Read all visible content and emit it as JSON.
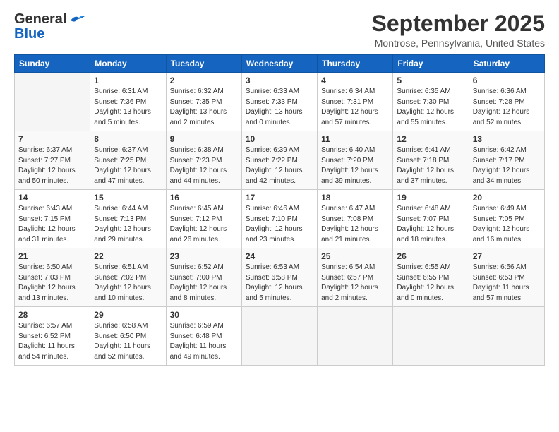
{
  "logo": {
    "line1": "General",
    "line2": "Blue"
  },
  "title": "September 2025",
  "location": "Montrose, Pennsylvania, United States",
  "days_of_week": [
    "Sunday",
    "Monday",
    "Tuesday",
    "Wednesday",
    "Thursday",
    "Friday",
    "Saturday"
  ],
  "weeks": [
    [
      {
        "day": "",
        "info": ""
      },
      {
        "day": "1",
        "info": "Sunrise: 6:31 AM\nSunset: 7:36 PM\nDaylight: 13 hours\nand 5 minutes."
      },
      {
        "day": "2",
        "info": "Sunrise: 6:32 AM\nSunset: 7:35 PM\nDaylight: 13 hours\nand 2 minutes."
      },
      {
        "day": "3",
        "info": "Sunrise: 6:33 AM\nSunset: 7:33 PM\nDaylight: 13 hours\nand 0 minutes."
      },
      {
        "day": "4",
        "info": "Sunrise: 6:34 AM\nSunset: 7:31 PM\nDaylight: 12 hours\nand 57 minutes."
      },
      {
        "day": "5",
        "info": "Sunrise: 6:35 AM\nSunset: 7:30 PM\nDaylight: 12 hours\nand 55 minutes."
      },
      {
        "day": "6",
        "info": "Sunrise: 6:36 AM\nSunset: 7:28 PM\nDaylight: 12 hours\nand 52 minutes."
      }
    ],
    [
      {
        "day": "7",
        "info": "Sunrise: 6:37 AM\nSunset: 7:27 PM\nDaylight: 12 hours\nand 50 minutes."
      },
      {
        "day": "8",
        "info": "Sunrise: 6:37 AM\nSunset: 7:25 PM\nDaylight: 12 hours\nand 47 minutes."
      },
      {
        "day": "9",
        "info": "Sunrise: 6:38 AM\nSunset: 7:23 PM\nDaylight: 12 hours\nand 44 minutes."
      },
      {
        "day": "10",
        "info": "Sunrise: 6:39 AM\nSunset: 7:22 PM\nDaylight: 12 hours\nand 42 minutes."
      },
      {
        "day": "11",
        "info": "Sunrise: 6:40 AM\nSunset: 7:20 PM\nDaylight: 12 hours\nand 39 minutes."
      },
      {
        "day": "12",
        "info": "Sunrise: 6:41 AM\nSunset: 7:18 PM\nDaylight: 12 hours\nand 37 minutes."
      },
      {
        "day": "13",
        "info": "Sunrise: 6:42 AM\nSunset: 7:17 PM\nDaylight: 12 hours\nand 34 minutes."
      }
    ],
    [
      {
        "day": "14",
        "info": "Sunrise: 6:43 AM\nSunset: 7:15 PM\nDaylight: 12 hours\nand 31 minutes."
      },
      {
        "day": "15",
        "info": "Sunrise: 6:44 AM\nSunset: 7:13 PM\nDaylight: 12 hours\nand 29 minutes."
      },
      {
        "day": "16",
        "info": "Sunrise: 6:45 AM\nSunset: 7:12 PM\nDaylight: 12 hours\nand 26 minutes."
      },
      {
        "day": "17",
        "info": "Sunrise: 6:46 AM\nSunset: 7:10 PM\nDaylight: 12 hours\nand 23 minutes."
      },
      {
        "day": "18",
        "info": "Sunrise: 6:47 AM\nSunset: 7:08 PM\nDaylight: 12 hours\nand 21 minutes."
      },
      {
        "day": "19",
        "info": "Sunrise: 6:48 AM\nSunset: 7:07 PM\nDaylight: 12 hours\nand 18 minutes."
      },
      {
        "day": "20",
        "info": "Sunrise: 6:49 AM\nSunset: 7:05 PM\nDaylight: 12 hours\nand 16 minutes."
      }
    ],
    [
      {
        "day": "21",
        "info": "Sunrise: 6:50 AM\nSunset: 7:03 PM\nDaylight: 12 hours\nand 13 minutes."
      },
      {
        "day": "22",
        "info": "Sunrise: 6:51 AM\nSunset: 7:02 PM\nDaylight: 12 hours\nand 10 minutes."
      },
      {
        "day": "23",
        "info": "Sunrise: 6:52 AM\nSunset: 7:00 PM\nDaylight: 12 hours\nand 8 minutes."
      },
      {
        "day": "24",
        "info": "Sunrise: 6:53 AM\nSunset: 6:58 PM\nDaylight: 12 hours\nand 5 minutes."
      },
      {
        "day": "25",
        "info": "Sunrise: 6:54 AM\nSunset: 6:57 PM\nDaylight: 12 hours\nand 2 minutes."
      },
      {
        "day": "26",
        "info": "Sunrise: 6:55 AM\nSunset: 6:55 PM\nDaylight: 12 hours\nand 0 minutes."
      },
      {
        "day": "27",
        "info": "Sunrise: 6:56 AM\nSunset: 6:53 PM\nDaylight: 11 hours\nand 57 minutes."
      }
    ],
    [
      {
        "day": "28",
        "info": "Sunrise: 6:57 AM\nSunset: 6:52 PM\nDaylight: 11 hours\nand 54 minutes."
      },
      {
        "day": "29",
        "info": "Sunrise: 6:58 AM\nSunset: 6:50 PM\nDaylight: 11 hours\nand 52 minutes."
      },
      {
        "day": "30",
        "info": "Sunrise: 6:59 AM\nSunset: 6:48 PM\nDaylight: 11 hours\nand 49 minutes."
      },
      {
        "day": "",
        "info": ""
      },
      {
        "day": "",
        "info": ""
      },
      {
        "day": "",
        "info": ""
      },
      {
        "day": "",
        "info": ""
      }
    ]
  ]
}
